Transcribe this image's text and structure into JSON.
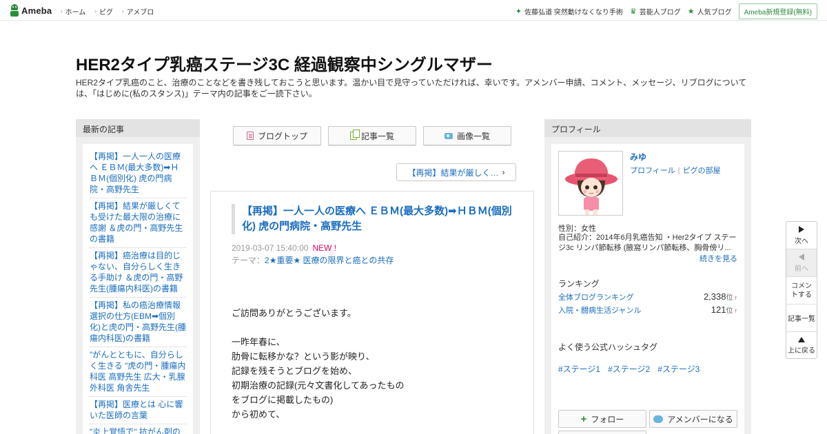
{
  "topbar": {
    "logo": "Ameba",
    "nav": [
      "ホーム",
      "ピグ",
      "アメブロ"
    ],
    "right_links": [
      {
        "icon": "sparkle-icon",
        "label": "佐藤弘道 突然動けなくなり手術"
      },
      {
        "icon": "crown-icon",
        "label": "芸能人ブログ"
      },
      {
        "icon": "star-icon",
        "label": "人気ブログ"
      }
    ],
    "register": "Ameba新規登録(無料)"
  },
  "blog": {
    "title": "HER2タイプ乳癌ステージ3C 経過観察中シングルマザー",
    "description": "HER2タイプ乳癌のこと、治療のことなどを書き残しておこうと思います。温かい目で見守っていただければ、幸いです。アメンバー申請、コメント、メッセージ、リブログについては、「はじめに(私のスタンス)」テーマ内の記事をご一読下さい。"
  },
  "recent": {
    "heading": "最新の記事",
    "entries": [
      "【再掲】一人一人の医療へ ＥＢＭ(最大多数)➡ＨＢＭ(個別化) 虎の門病院・高野先生",
      "【再掲】結果が厳しくても受けた最大限の治療に感謝 ＆虎の門・高野先生の書籍",
      "【再掲】癌治療は目的じゃない、自分らしく生きる手助け ＆虎の門・高野先生(腫瘍内科医)の書籍",
      "【再掲】私の癌治療情報選択の仕方(EBM➡個別化)と虎の門・高野先生(腫瘍内科医)の書籍",
      "\"がんとともに、自分らしく生きる \"虎の門・腫瘍内科医 高野先生 広大・乳腺外科医 角舎先生",
      "【再掲】医療とは 心に響いた医師の言葉",
      "\"炎上覚悟で\" 抗がん剤の"
    ]
  },
  "tabs": [
    {
      "icon": "document-icon",
      "label": "ブログトップ"
    },
    {
      "icon": "list-icon",
      "label": "記事一覧"
    },
    {
      "icon": "camera-icon",
      "label": "画像一覧"
    }
  ],
  "prev_article": "【再掲】結果が厳しく…",
  "article": {
    "title": "【再掲】一人一人の医療へ ＥＢＭ(最大多数)➡ＨＢＭ(個別化) 虎の門病院・高野先生",
    "datetime": "2019-03-07 15:40:00",
    "new_badge": "NEW !",
    "theme_label": "テーマ：",
    "theme": "2★重要★ 医療の限界と癌との共存",
    "body": [
      "ご訪問ありがとうございます。",
      "",
      "一昨年春に、",
      "肋骨に転移かな？という影が映り、",
      "記録を残そうとブログを始め、",
      "初期治療の記録(元々文書化してあったもの",
      "をブログに掲載したもの)",
      "から初めて、"
    ]
  },
  "profile": {
    "heading": "プロフィール",
    "name": "みゆ",
    "link_profile": "プロフィール",
    "link_room": "ピグの部屋",
    "gender": "性別：女性",
    "intro": "自己紹介：2014年6月乳癌告知 ・Her2タイプ ステージ3c リンパ節転移 (腋窩リンパ節転移、胸骨傍リ...",
    "more": "続きを見る",
    "ranking_heading": "ランキング",
    "rankings": [
      {
        "label": "全体ブログランキング",
        "value": "2,338",
        "unit": "位",
        "trend": "↑"
      },
      {
        "label": "入院・闘病生活ジャンル",
        "value": "121",
        "unit": "位",
        "trend": "↑"
      }
    ],
    "hashtag_heading": "よく使う公式ハッシュタグ",
    "hashtags": [
      "#ステージ1",
      "#ステージ2",
      "#ステージ3"
    ],
    "follow": "フォロー",
    "member": "アメンバーになる"
  },
  "floatnav": {
    "next": "次へ",
    "prev": "前へ",
    "comment": "コメントする",
    "list": "記事一覧",
    "top": "上に戻る"
  },
  "colors": {
    "brand_green": "#2d8c3c",
    "link_blue": "#1a6cc0",
    "new_pink": "#e60067"
  }
}
